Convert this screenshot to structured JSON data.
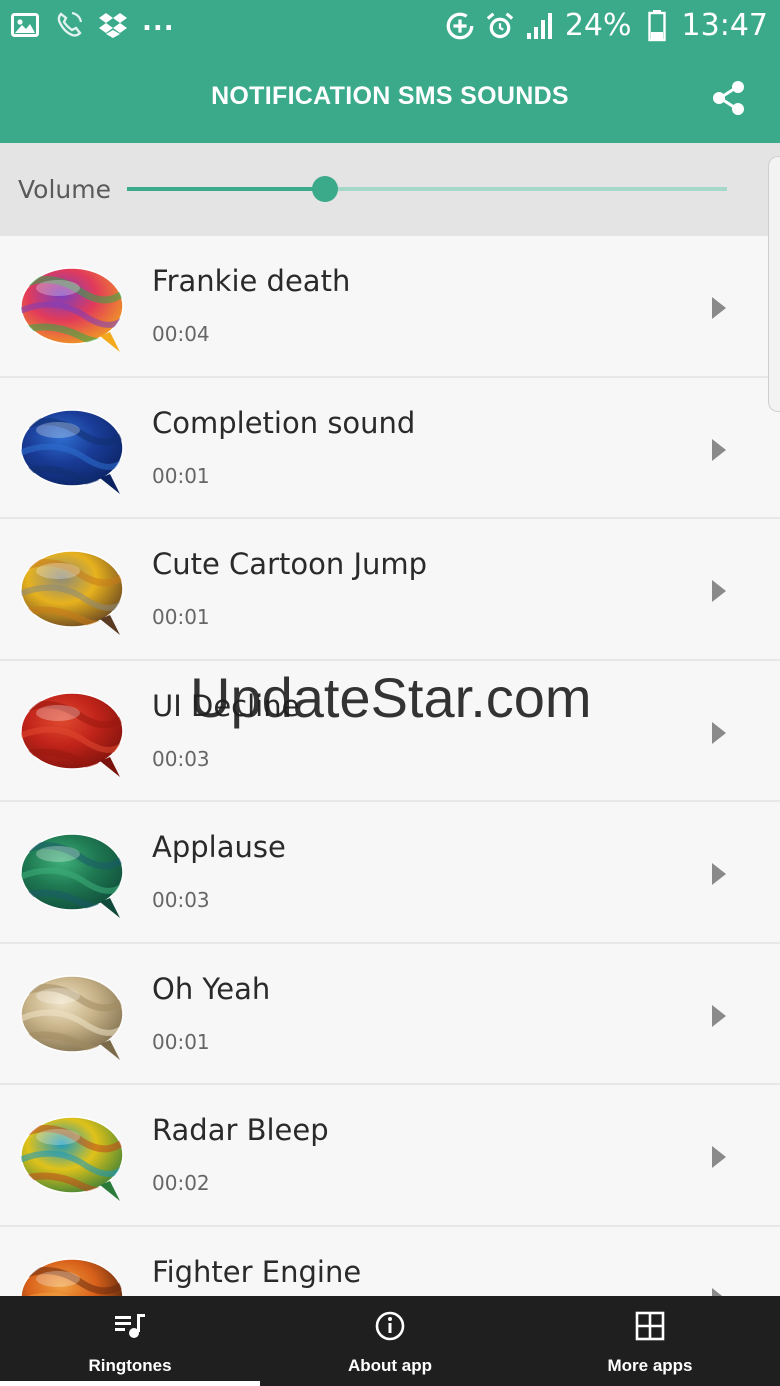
{
  "status_bar": {
    "left_icons": [
      "image-icon",
      "call-icon",
      "dropbox-icon"
    ],
    "dots": "...",
    "battery": "24%",
    "time": "13:47"
  },
  "app_bar": {
    "title": "NOTIFICATION SMS SOUNDS",
    "share_icon": "share-icon"
  },
  "volume": {
    "label": "Volume",
    "level": 0.33
  },
  "sounds": [
    {
      "title": "Frankie death",
      "duration": "00:04",
      "art": [
        "#e23b5a",
        "#f2a91b",
        "#7a3fc0",
        "#2fa84a"
      ]
    },
    {
      "title": "Completion sound",
      "duration": "00:01",
      "art": [
        "#1a3c98",
        "#0b2260",
        "#2e6fd0",
        "#113070"
      ]
    },
    {
      "title": "Cute Cartoon Jump",
      "duration": "00:01",
      "art": [
        "#e7b21e",
        "#5b3a22",
        "#8c8a7a",
        "#c87a1a"
      ]
    },
    {
      "title": "UI Decline",
      "duration": "00:03",
      "art": [
        "#c2241a",
        "#7a120c",
        "#e04a30",
        "#9a1810"
      ]
    },
    {
      "title": "Applause",
      "duration": "00:03",
      "art": [
        "#1f7a52",
        "#0f4a3a",
        "#3fb07a",
        "#1a5a6a"
      ]
    },
    {
      "title": "Oh Yeah",
      "duration": "00:01",
      "art": [
        "#c9b48a",
        "#7a6a4a",
        "#efe3c6",
        "#a08a62"
      ]
    },
    {
      "title": "Radar Bleep",
      "duration": "00:02",
      "art": [
        "#e0c21a",
        "#2a7a3a",
        "#1a9ac0",
        "#c04a1a"
      ]
    },
    {
      "title": "Fighter Engine",
      "duration": "",
      "art": [
        "#d8601a",
        "#3a1a0a",
        "#f0a040",
        "#6a2a10"
      ]
    }
  ],
  "watermark": "UpdateStar.com",
  "bottom_nav": {
    "items": [
      {
        "label": "Ringtones",
        "icon": "playlist-icon"
      },
      {
        "label": "About app",
        "icon": "info-icon"
      },
      {
        "label": "More apps",
        "icon": "grid-icon"
      }
    ],
    "active_index": 0
  }
}
